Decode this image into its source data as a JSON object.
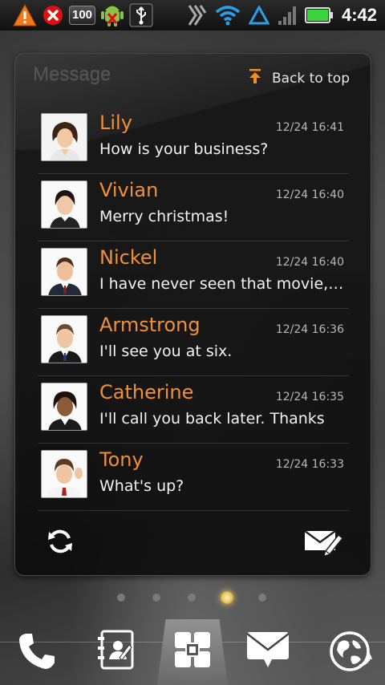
{
  "status_bar": {
    "notification_count": "100",
    "time": "4:42"
  },
  "widget": {
    "title": "Message",
    "back_to_top_label": "Back to top",
    "messages": [
      {
        "name": "Lily",
        "time": "12/24 16:41",
        "text": "How is your business?"
      },
      {
        "name": "Vivian",
        "time": "12/24 16:40",
        "text": "Merry christmas!"
      },
      {
        "name": "Nickel",
        "time": "12/24 16:40",
        "text": "I have never seen that movie, d..."
      },
      {
        "name": "Armstrong",
        "time": "12/24 16:36",
        "text": "I'll see you at six."
      },
      {
        "name": "Catherine",
        "time": "12/24 16:35",
        "text": "I'll call you back later. Thanks"
      },
      {
        "name": "Tony",
        "time": "12/24 16:33",
        "text": "What's up?"
      }
    ],
    "footer": {
      "refresh_icon": "refresh-icon",
      "compose_icon": "compose-message-icon"
    }
  },
  "page_indicator": {
    "page_count": 5,
    "active_page": 4
  },
  "dock": {
    "items": [
      "phone-icon",
      "contacts-icon",
      "app-drawer-icon",
      "messaging-icon",
      "browser-icon"
    ]
  },
  "colors": {
    "accent_name": "#f0903a",
    "status_bar_bg": "#111111",
    "battery_green": "#3cd43c",
    "signal_blue": "#2aa0e8"
  }
}
